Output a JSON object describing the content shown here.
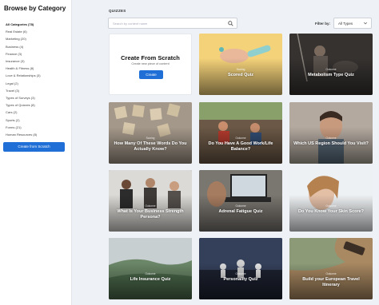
{
  "sidebar": {
    "title": "Browse by Category",
    "items": [
      {
        "label": "All Categories (78)"
      },
      {
        "label": "Real Estate (6)"
      },
      {
        "label": "Marketing (20)"
      },
      {
        "label": "Business (4)"
      },
      {
        "label": "Finance (3)"
      },
      {
        "label": "Insurance (3)"
      },
      {
        "label": "Health & Fitness (8)"
      },
      {
        "label": "Love & Relationships (3)"
      },
      {
        "label": "Legal (2)"
      },
      {
        "label": "Travel (3)"
      },
      {
        "label": "Types of Surveys (3)"
      },
      {
        "label": "Types of Quizzes (8)"
      },
      {
        "label": "Cars (2)"
      },
      {
        "label": "Sports (2)"
      },
      {
        "label": "Forms (21)"
      },
      {
        "label": "Human Resources (8)"
      }
    ],
    "create_button": "Create from Scratch"
  },
  "main": {
    "section_label": "QUIZZES",
    "search": {
      "placeholder": "Search by content name"
    },
    "filter": {
      "label": "Filter by:",
      "selected": "All Types"
    },
    "scratch_card": {
      "title": "Create From Scratch",
      "subtitle": "Create new piece of content",
      "button": "Create"
    },
    "cards": [
      {
        "title": "Scored Quiz",
        "badge": "Scoring"
      },
      {
        "title": "Metabolism Type Quiz",
        "badge": "Outcome"
      },
      {
        "title": "How Many Of These Words Do You Actually Know?",
        "badge": "Scoring"
      },
      {
        "title": "Do You Have A Good Work/Life Balance?",
        "badge": "Outcome"
      },
      {
        "title": "Which US Region Should You Visit?",
        "badge": "Outcome"
      },
      {
        "title": "What Is Your Business Strength Persona?",
        "badge": "Outcome"
      },
      {
        "title": "Adrenal Fatigue Quiz",
        "badge": "Outcome"
      },
      {
        "title": "Do You Know Your Skin Score?",
        "badge": "Outcome"
      },
      {
        "title": "Life Insurance Quiz",
        "badge": "Outcome"
      },
      {
        "title": "Personality Quiz",
        "badge": "Outcome"
      },
      {
        "title": "Build your European Travel Itinerary",
        "badge": "Outcome"
      }
    ]
  },
  "colors": {
    "accent": "#1f6fd6",
    "background": "#eef1f6"
  }
}
